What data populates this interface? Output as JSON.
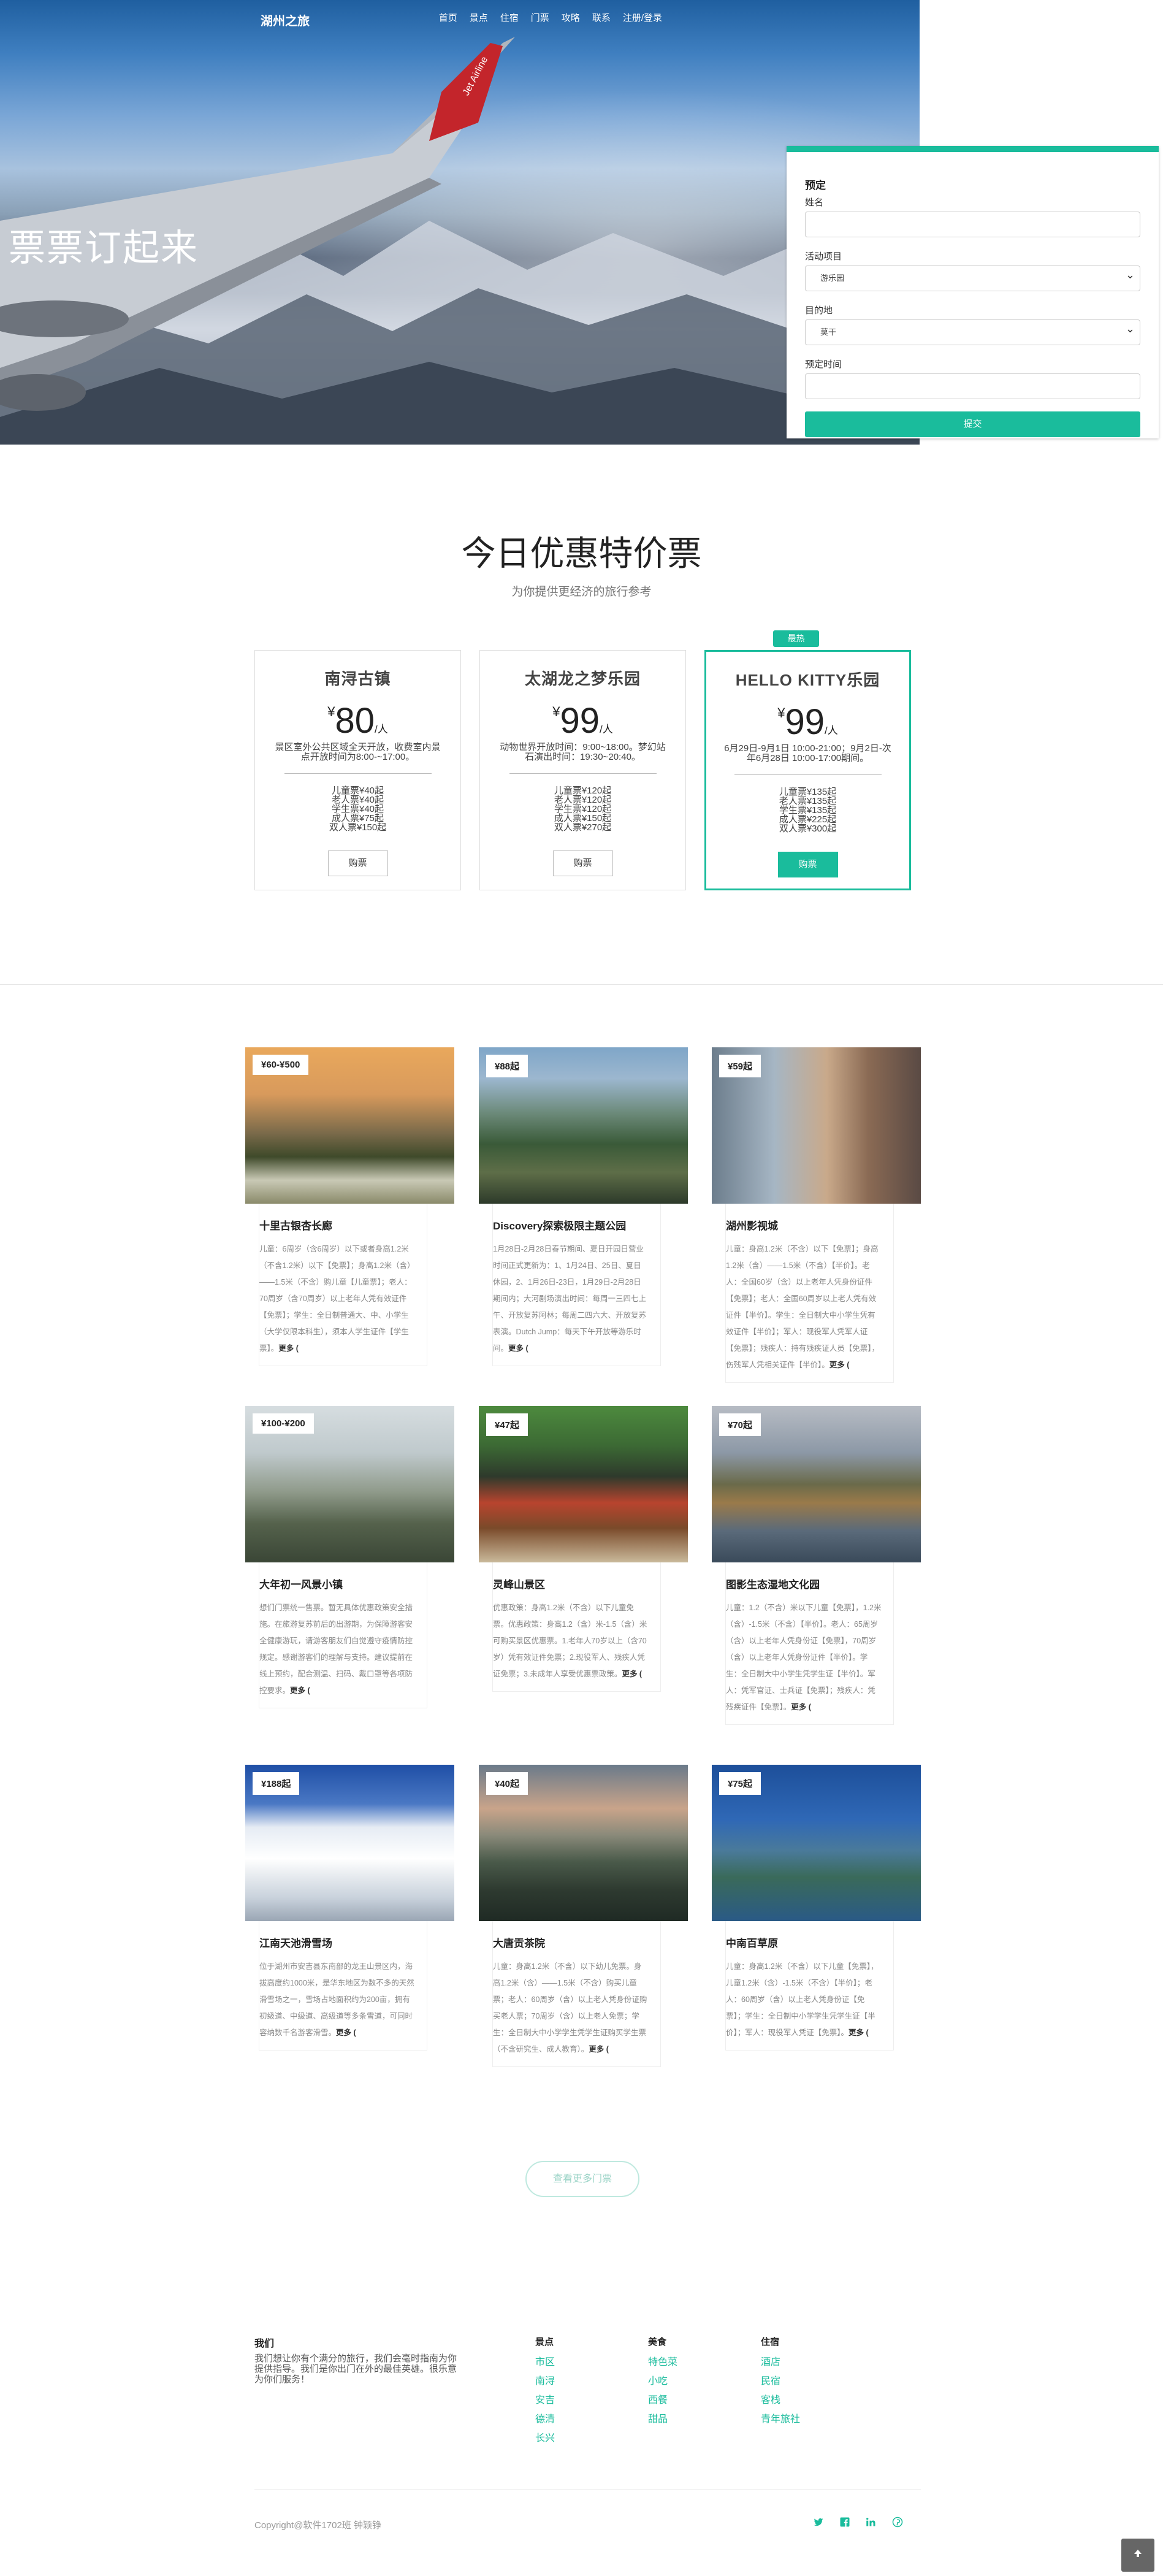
{
  "nav": {
    "brand": "湖州之旅",
    "links": [
      "首页",
      "景点",
      "住宿",
      "门票",
      "攻略",
      "联系",
      "注册/登录"
    ]
  },
  "hero": {
    "slogan": "票票订起来",
    "wing_text": "Jet Airline"
  },
  "booking": {
    "title": "预定",
    "name_label": "姓名",
    "name_value": "",
    "activity_label": "活动项目",
    "activity_value": "游乐园",
    "destination_label": "目的地",
    "destination_value": "莫干",
    "time_label": "预定时间",
    "time_value": "",
    "submit_label": "提交"
  },
  "specials": {
    "title": "今日优惠特价票",
    "subtitle": "为你提供更经济的旅行参考",
    "badge": "最热",
    "tickets": [
      {
        "name": "南浔古镇",
        "currency": "¥",
        "price": "80",
        "unit": "/人",
        "desc": "景区室外公共区域全天开放，收费室内景点开放时间为8:00-~17:00。",
        "items": [
          "儿童票¥40起",
          "老人票¥40起",
          "学生票¥40起",
          "成人票¥75起",
          "双人票¥150起"
        ],
        "buy": "购票"
      },
      {
        "name": "太湖龙之梦乐园",
        "currency": "¥",
        "price": "99",
        "unit": "/人",
        "desc": "动物世界开放时间：9:00~18:00。梦幻站石演出时间：19:30~20:40。",
        "items": [
          "儿童票¥120起",
          "老人票¥120起",
          "学生票¥120起",
          "成人票¥150起",
          "双人票¥270起"
        ],
        "buy": "购票"
      },
      {
        "name": "HELLO KITTY乐园",
        "currency": "¥",
        "price": "99",
        "unit": "/人",
        "desc": "6月29日-9月1日 10:00-21:00；9月2日-次年6月28日 10:00-17:00期间。",
        "items": [
          "儿童票¥135起",
          "老人票¥135起",
          "学生票¥135起",
          "成人票¥225起",
          "双人票¥300起"
        ],
        "buy": "购票"
      }
    ]
  },
  "destinations": [
    {
      "price": "¥60-¥500",
      "name": "十里古银杏长廊",
      "text": "儿童：6周岁（含6周岁）以下或者身高1.2米（不含1.2米）以下【免票】；身高1.2米（含）——1.5米（不含）购儿童【儿童票】；老人：70周岁（含70周岁）以上老年人凭有效证件【免票】；学生：全日制普通大、中、小学生（大学仅限本科生），须本人学生证件【学生票】。",
      "more": "更多 ("
    },
    {
      "price": "¥88起",
      "name": "Discovery探索极限主题公园",
      "text": "1月28日-2月28日春节期间、夏日开园日营业时间正式更新为：1、1月24日、25日、夏日休园，2、1月26日-23日，1月29日-2月28日期间内；大河剧场演出时间：每周一三四七上午、开放复苏阿林；每周二四六大、开放复苏表演。Dutch Jump：每天下午开放等游乐时间。",
      "more": "更多 ("
    },
    {
      "price": "¥59起",
      "name": "湖州影视城",
      "text": "儿童：身高1.2米（不含）以下【免票】；身高1.2米（含）——1.5米（不含）【半价】。老人：全国60岁（含）以上老年人凭身份证件【免票】；老人：全国60周岁以上老人凭有效证件【半价】。学生：全日制大中小学生凭有效证件【半价】；军人：现役军人凭军人证【免票】；残疾人：持有残疾证人员【免票】，伤残军人凭相关证件【半价】。",
      "more": "更多 ("
    },
    {
      "price": "¥100-¥200",
      "name": "大年初一风景小镇",
      "text": "想们门票统一售票。暂无具体优惠政策安全措施。在旅游复苏前后的出游期，为保障游客安全健康游玩，请游客朋友们自觉遵守疫情防控规定。感谢游客们的理解与支持。建议提前在线上预约，配合测温、扫码、戴口罩等各项防控要求。",
      "more": "更多 ("
    },
    {
      "price": "¥47起",
      "name": "灵峰山景区",
      "text": "优惠政策：身高1.2米（不含）以下儿童免票。优惠政策：身高1.2（含）米-1.5（含）米可购买景区优惠票。1.老年人70岁以上（含70岁）凭有效证件免票；2.现役军人、残疾人凭证免票；3.未成年人享受优惠票政策。",
      "more": "更多 ("
    },
    {
      "price": "¥70起",
      "name": "图影生态湿地文化园",
      "text": "儿童：1.2（不含）米以下儿童【免票】，1.2米（含）-1.5米（不含）【半价】。老人：65周岁（含）以上老年人凭身份证【免票】，70周岁（含）以上老年人凭身份证件【半价】。学生：全日制大中小学生凭学生证【半价】。军人：凭军官证、士兵证【免票】；残疾人：凭残疾证件【免票】。",
      "more": "更多 ("
    },
    {
      "price": "¥188起",
      "name": "江南天池滑雪场",
      "text": "位于湖州市安吉县东南部的龙王山景区内，海拔高度约1000米，是华东地区为数不多的天然滑雪场之一，雪场占地面积约为200亩，拥有初级道、中级道、高级道等多条雪道，可同时容纳数千名游客滑雪。",
      "more": "更多 ("
    },
    {
      "price": "¥40起",
      "name": "大唐贡茶院",
      "text": "儿童：身高1.2米（不含）以下幼儿免票。身高1.2米（含）——1.5米（不含）购买儿童票；老人：60周岁（含）以上老人凭身份证购买老人票；70周岁（含）以上老人免票；学生：全日制大中小学学生凭学生证购买学生票（不含研究生、成人教育）。",
      "more": "更多 ("
    },
    {
      "price": "¥75起",
      "name": "中南百草原",
      "text": "儿童：身高1.2米（不含）以下儿童【免票】，儿童1.2米（含）-1.5米（不含）【半价】；老人：60周岁（含）以上老人凭身份证【免票】；学生：全日制中小学学生凭学生证【半价】；军人：现役军人凭证【免票】。",
      "more": "更多 ("
    }
  ],
  "more_button": "查看更多门票",
  "footer": {
    "about_title": "我们",
    "about_text": "我们想让你有个满分的旅行，我们会毫时指南为你提供指导。我们是你出门在外的最佳英雄。很乐意为你们服务！",
    "cols": [
      {
        "title": "景点",
        "links": [
          "市区",
          "南浔",
          "安吉",
          "德清",
          "长兴"
        ]
      },
      {
        "title": "美食",
        "links": [
          "特色菜",
          "小吃",
          "西餐",
          "甜品"
        ]
      },
      {
        "title": "住宿",
        "links": [
          "酒店",
          "民宿",
          "客栈",
          "青年旅社"
        ]
      }
    ],
    "copyright": "Copyright@软件1702班 钟颖铮",
    "social": [
      "twitter-icon",
      "facebook-icon",
      "linkedin-icon",
      "pinterest-icon"
    ]
  },
  "colors": {
    "accent": "#1abc9c"
  }
}
